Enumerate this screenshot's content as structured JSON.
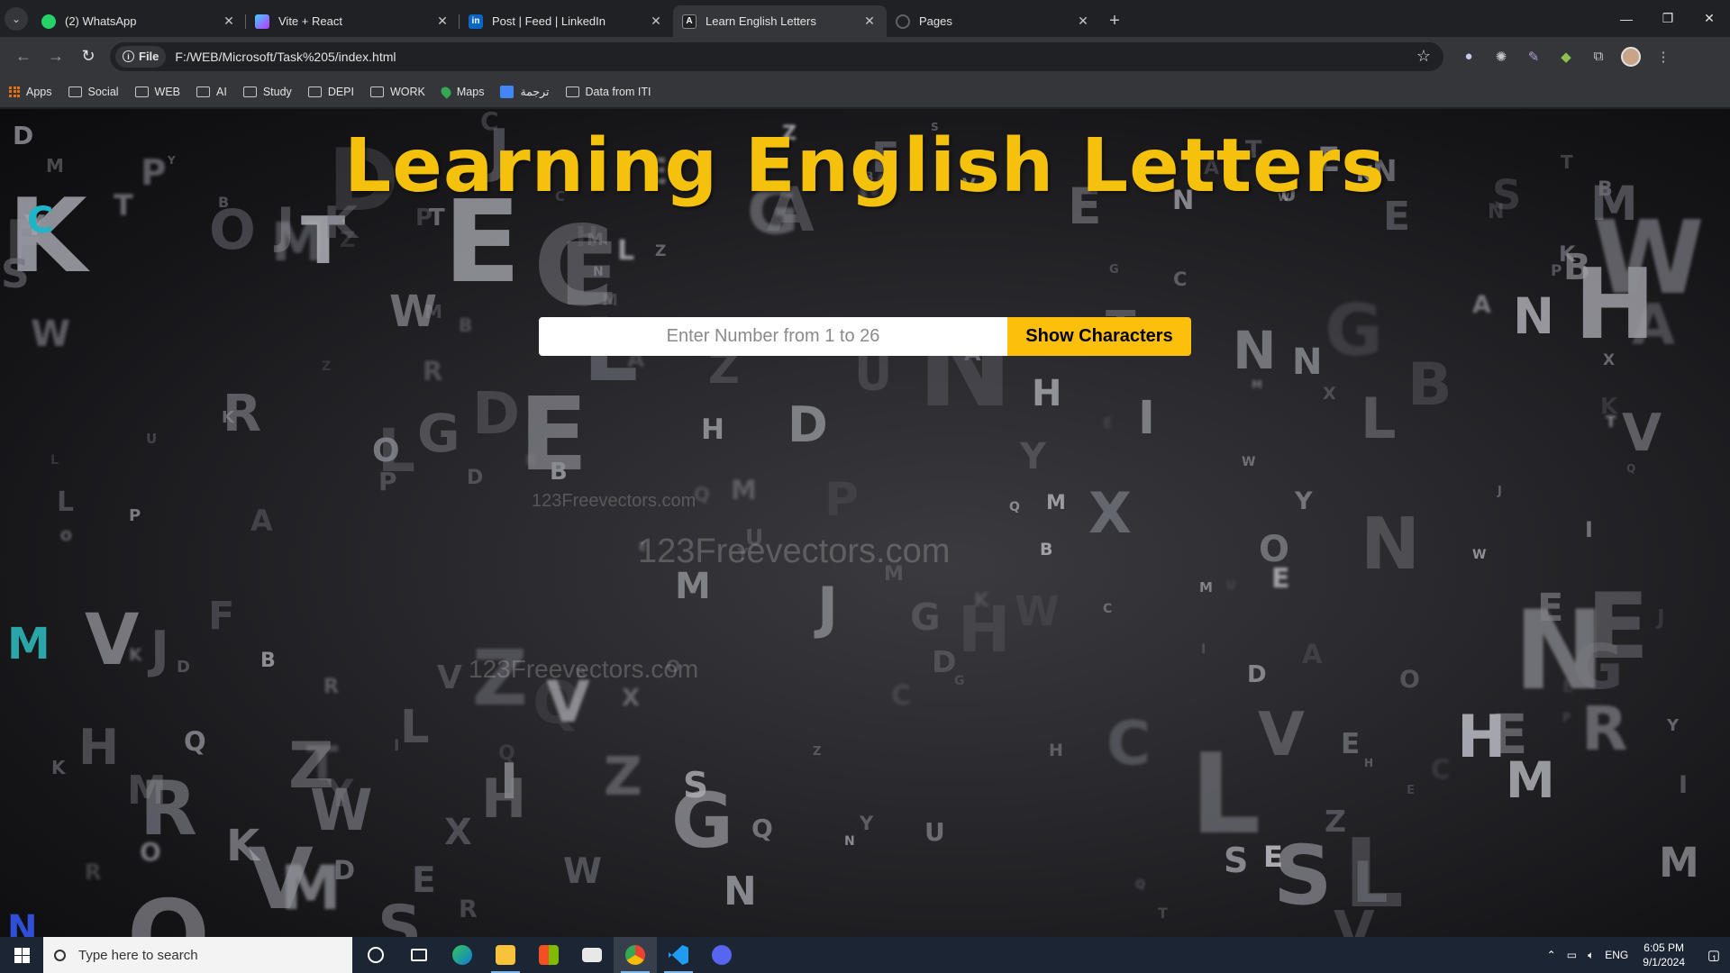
{
  "browser": {
    "tabs": [
      {
        "title": "(2) WhatsApp",
        "favicon": "whatsapp-icon",
        "color": "#25d366",
        "active": false
      },
      {
        "title": "Vite + React",
        "favicon": "vite-icon",
        "color": "#a259ff",
        "active": false
      },
      {
        "title": "Post | Feed | LinkedIn",
        "favicon": "linkedin-icon",
        "color": "#0a66c2",
        "active": false
      },
      {
        "title": "Learn English Letters",
        "favicon": "page-a-icon",
        "color": "#3c4043",
        "active": true
      },
      {
        "title": "Pages",
        "favicon": "loading-icon",
        "color": "#5f6368",
        "active": false
      }
    ],
    "address": {
      "chip": "File",
      "url": "F:/WEB/Microsoft/Task%205/index.html"
    },
    "bookmarks": [
      {
        "label": "Apps",
        "icon": "apps-grid-icon"
      },
      {
        "label": "Social",
        "icon": "folder-icon"
      },
      {
        "label": "WEB",
        "icon": "folder-icon"
      },
      {
        "label": "AI",
        "icon": "folder-icon"
      },
      {
        "label": "Study",
        "icon": "folder-icon"
      },
      {
        "label": "DEPI",
        "icon": "folder-icon"
      },
      {
        "label": "WORK",
        "icon": "folder-icon"
      },
      {
        "label": "Maps",
        "icon": "maps-pin-icon"
      },
      {
        "label": "ترجمة",
        "icon": "translate-icon"
      },
      {
        "label": "Data from ITI",
        "icon": "folder-icon"
      }
    ]
  },
  "page": {
    "heading": "Learning English Letters",
    "input_placeholder": "Enter Number from 1 to 26",
    "input_value": "",
    "button_label": "Show Characters",
    "accent_color": "#fbbf0c",
    "watermark": "123Freevectors.com"
  },
  "taskbar": {
    "search_placeholder": "Type here to search",
    "language": "ENG",
    "time": "6:05 PM",
    "date": "9/1/2024",
    "notification_count": "1"
  }
}
